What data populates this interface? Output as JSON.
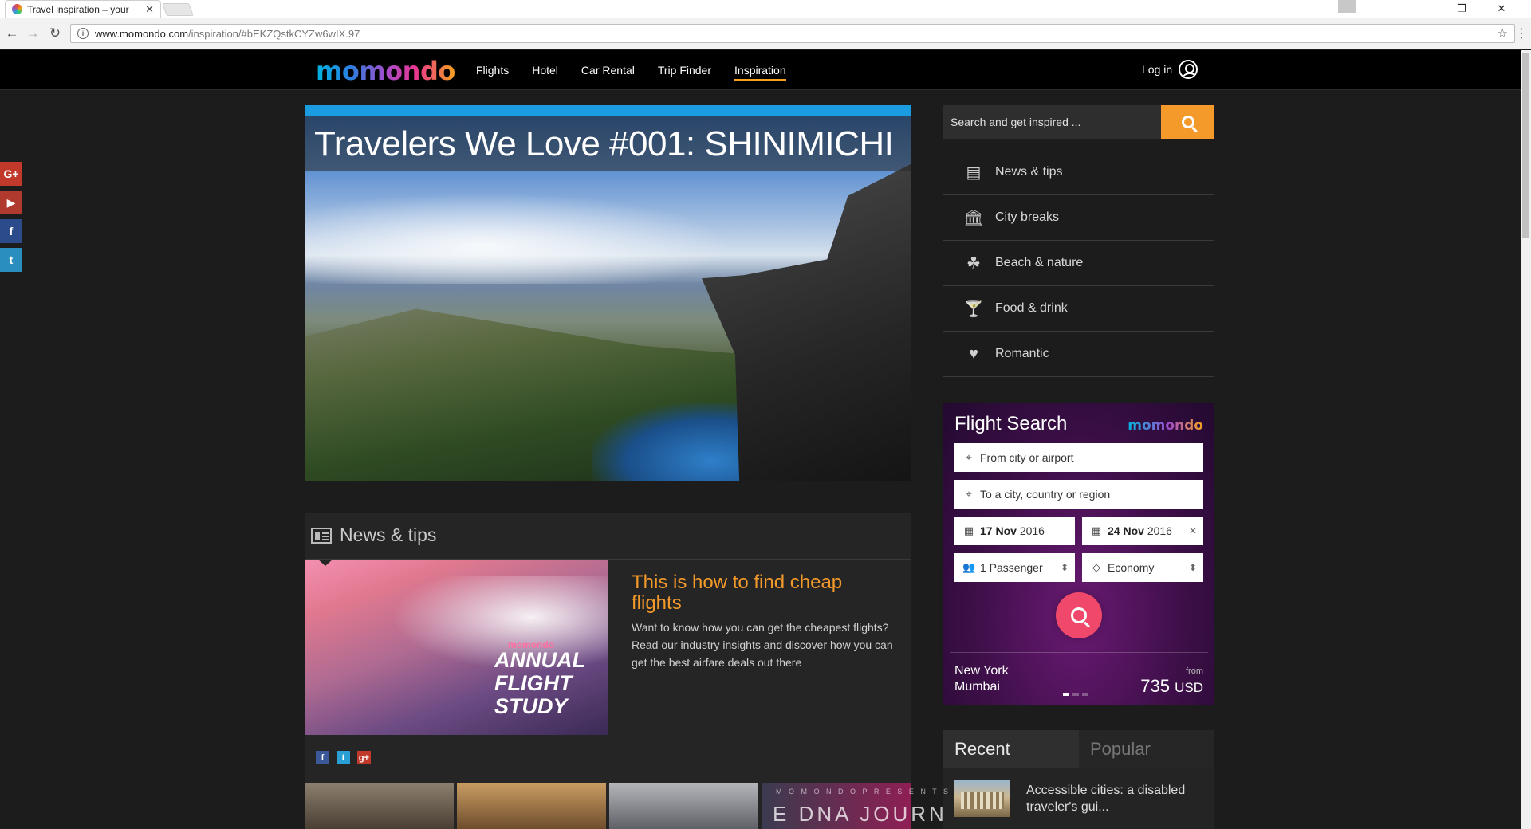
{
  "browser": {
    "tab_title": "Travel inspiration – your",
    "tab_close": "✕",
    "url_host": "www.momondo.com",
    "url_path": "/inspiration/#bEKZQstkCYZw6wIX.97",
    "minimize": "—",
    "restore": "❐",
    "close": "✕"
  },
  "header": {
    "logo": "momondo",
    "nav": [
      "Flights",
      "Hotel",
      "Car Rental",
      "Trip Finder",
      "Inspiration"
    ],
    "active_nav": "Inspiration",
    "login": "Log in"
  },
  "social": [
    "G+",
    "▶",
    "f",
    "t"
  ],
  "hero": {
    "title": "Travelers We Love #001: SHINIMICHI"
  },
  "site_search": {
    "placeholder": "Search and get inspired ..."
  },
  "categories": [
    {
      "label": "News & tips",
      "icon": "newspaper-icon"
    },
    {
      "label": "City breaks",
      "icon": "building-icon"
    },
    {
      "label": "Beach & nature",
      "icon": "flipflops-icon"
    },
    {
      "label": "Food & drink",
      "icon": "cocktail-icon"
    },
    {
      "label": "Romantic",
      "icon": "heart-icon"
    }
  ],
  "flight_search": {
    "title": "Flight Search",
    "logo": "momondo",
    "from_placeholder": "From city or airport",
    "to_placeholder": "To a city, country or region",
    "depart_day": "17 Nov",
    "depart_year": "2016",
    "return_day": "24 Nov",
    "return_year": "2016",
    "passengers": "1 Passenger",
    "cabin": "Economy",
    "deal_from_city": "New York",
    "deal_to_city": "Mumbai",
    "deal_from_label": "from",
    "deal_price": "735",
    "deal_currency": "USD",
    "carousel_active": 1,
    "carousel_count": 3
  },
  "recent_popular": {
    "tabs": [
      "Recent",
      "Popular"
    ],
    "active": "Recent",
    "item_title": "Accessible cities: a disabled traveler's gui..."
  },
  "news": {
    "heading": "News & tips",
    "image_brand": "momondo",
    "image_text": "ANNUAL FLIGHT STUDY",
    "title": "This is how to find cheap flights",
    "description": "Want to know how you can get the cheapest flights? Read our industry insights and discover how you can get the best airfare deals out there",
    "thumb_caption": "M O M O N D O   P R E S E N T S",
    "thumb_text": "E DNA JOURN"
  },
  "colors": {
    "accent_orange": "#f39a2a",
    "header_bg": "#000000",
    "page_bg": "#1c1c1c",
    "hero_bar": "#1c9ce0",
    "flight_go": "#f0486a"
  }
}
